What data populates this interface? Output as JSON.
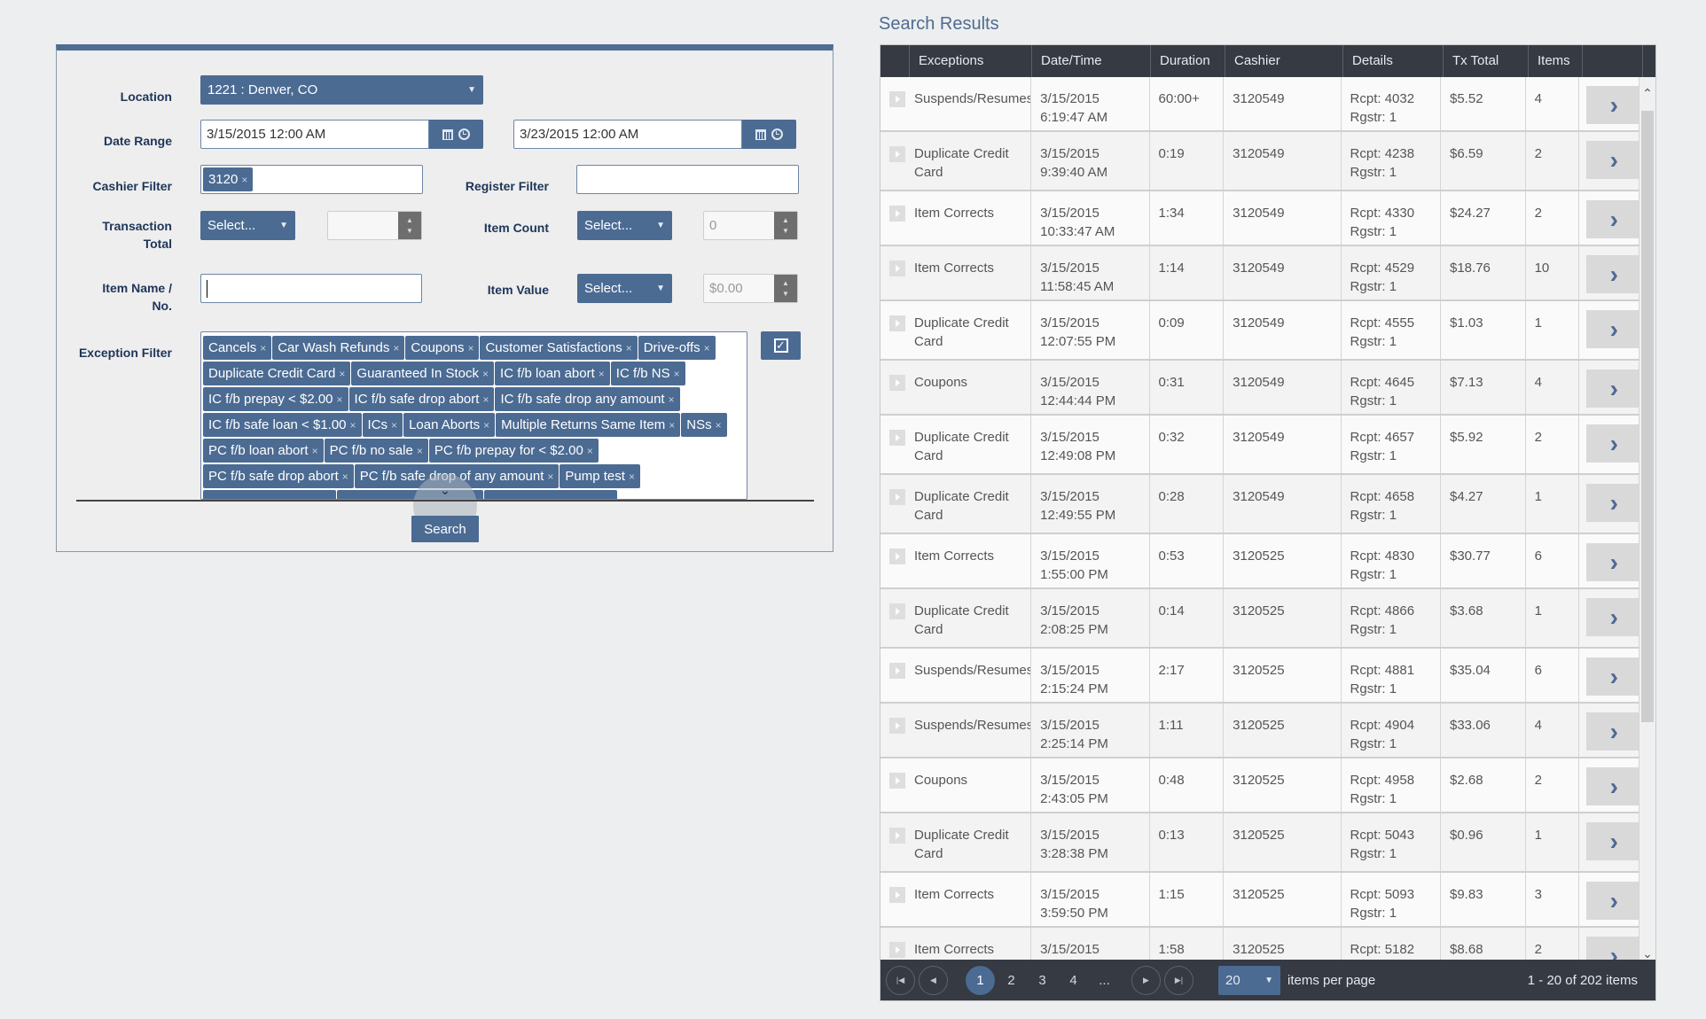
{
  "form": {
    "location_label": "Location",
    "location_value": "1221 : Denver, CO",
    "date_range_label": "Date Range",
    "date_from": "3/15/2015 12:00 AM",
    "date_to": "3/23/2015 12:00 AM",
    "cashier_filter_label": "Cashier Filter",
    "cashier_tags": [
      "3120"
    ],
    "register_filter_label": "Register Filter",
    "register_filter_value": "",
    "transaction_total_label_1": "Transaction",
    "transaction_total_label_2": "Total",
    "transaction_total_operator": "Select...",
    "transaction_total_value": "",
    "item_count_label": "Item Count",
    "item_count_operator": "Select...",
    "item_count_value": "0",
    "item_name_label_1": "Item Name /",
    "item_name_label_2": "No.",
    "item_name_value": "",
    "item_value_label": "Item Value",
    "item_value_operator": "Select...",
    "item_value_value": "$0.00",
    "exception_filter_label": "Exception Filter",
    "exception_tags": [
      "Cancels",
      "Car Wash Refunds",
      "Coupons",
      "Customer Satisfactions",
      "Drive-offs",
      "Duplicate Credit Card",
      "Guaranteed In Stock",
      "IC f/b loan abort",
      "IC f/b NS",
      "IC f/b prepay < $2.00",
      "IC f/b safe drop abort",
      "IC f/b safe drop any amount",
      "IC f/b safe loan < $1.00",
      "ICs",
      "Loan Aborts",
      "Multiple Returns Same Item",
      "NSs",
      "PC f/b loan abort",
      "PC f/b no sale",
      "PC f/b prepay for < $2.00",
      "PC f/b safe drop abort",
      "PC f/b safe drop of any amount",
      "Pump test"
    ],
    "search_label": "Search",
    "remove_glyph": "×"
  },
  "results": {
    "title": "Search Results",
    "columns": [
      "Exceptions",
      "Date/Time",
      "Duration",
      "Cashier",
      "Details",
      "Tx Total",
      "Items"
    ],
    "rows": [
      {
        "exception": "Suspends/Resumes",
        "date": "3/15/2015",
        "time": "6:19:47 AM",
        "duration": "60:00+",
        "cashier": "3120549",
        "rcpt": "Rcpt: 4032",
        "rgstr": "Rgstr: 1",
        "total": "$5.52",
        "items": "4"
      },
      {
        "exception": "Duplicate Credit Card",
        "date": "3/15/2015",
        "time": "9:39:40 AM",
        "duration": "0:19",
        "cashier": "3120549",
        "rcpt": "Rcpt: 4238",
        "rgstr": "Rgstr: 1",
        "total": "$6.59",
        "items": "2"
      },
      {
        "exception": "Item Corrects",
        "date": "3/15/2015",
        "time": "10:33:47 AM",
        "duration": "1:34",
        "cashier": "3120549",
        "rcpt": "Rcpt: 4330",
        "rgstr": "Rgstr: 1",
        "total": "$24.27",
        "items": "2"
      },
      {
        "exception": "Item Corrects",
        "date": "3/15/2015",
        "time": "11:58:45 AM",
        "duration": "1:14",
        "cashier": "3120549",
        "rcpt": "Rcpt: 4529",
        "rgstr": "Rgstr: 1",
        "total": "$18.76",
        "items": "10"
      },
      {
        "exception": "Duplicate Credit Card",
        "date": "3/15/2015",
        "time": "12:07:55 PM",
        "duration": "0:09",
        "cashier": "3120549",
        "rcpt": "Rcpt: 4555",
        "rgstr": "Rgstr: 1",
        "total": "$1.03",
        "items": "1"
      },
      {
        "exception": "Coupons",
        "date": "3/15/2015",
        "time": "12:44:44 PM",
        "duration": "0:31",
        "cashier": "3120549",
        "rcpt": "Rcpt: 4645",
        "rgstr": "Rgstr: 1",
        "total": "$7.13",
        "items": "4"
      },
      {
        "exception": "Duplicate Credit Card",
        "date": "3/15/2015",
        "time": "12:49:08 PM",
        "duration": "0:32",
        "cashier": "3120549",
        "rcpt": "Rcpt: 4657",
        "rgstr": "Rgstr: 1",
        "total": "$5.92",
        "items": "2"
      },
      {
        "exception": "Duplicate Credit Card",
        "date": "3/15/2015",
        "time": "12:49:55 PM",
        "duration": "0:28",
        "cashier": "3120549",
        "rcpt": "Rcpt: 4658",
        "rgstr": "Rgstr: 1",
        "total": "$4.27",
        "items": "1"
      },
      {
        "exception": "Item Corrects",
        "date": "3/15/2015",
        "time": "1:55:00 PM",
        "duration": "0:53",
        "cashier": "3120525",
        "rcpt": "Rcpt: 4830",
        "rgstr": "Rgstr: 1",
        "total": "$30.77",
        "items": "6"
      },
      {
        "exception": "Duplicate Credit Card",
        "date": "3/15/2015",
        "time": "2:08:25 PM",
        "duration": "0:14",
        "cashier": "3120525",
        "rcpt": "Rcpt: 4866",
        "rgstr": "Rgstr: 1",
        "total": "$3.68",
        "items": "1"
      },
      {
        "exception": "Suspends/Resumes",
        "date": "3/15/2015",
        "time": "2:15:24 PM",
        "duration": "2:17",
        "cashier": "3120525",
        "rcpt": "Rcpt: 4881",
        "rgstr": "Rgstr: 1",
        "total": "$35.04",
        "items": "6"
      },
      {
        "exception": "Suspends/Resumes",
        "date": "3/15/2015",
        "time": "2:25:14 PM",
        "duration": "1:11",
        "cashier": "3120525",
        "rcpt": "Rcpt: 4904",
        "rgstr": "Rgstr: 1",
        "total": "$33.06",
        "items": "4"
      },
      {
        "exception": "Coupons",
        "date": "3/15/2015",
        "time": "2:43:05 PM",
        "duration": "0:48",
        "cashier": "3120525",
        "rcpt": "Rcpt: 4958",
        "rgstr": "Rgstr: 1",
        "total": "$2.68",
        "items": "2"
      },
      {
        "exception": "Duplicate Credit Card",
        "date": "3/15/2015",
        "time": "3:28:38 PM",
        "duration": "0:13",
        "cashier": "3120525",
        "rcpt": "Rcpt: 5043",
        "rgstr": "Rgstr: 1",
        "total": "$0.96",
        "items": "1"
      },
      {
        "exception": "Item Corrects",
        "date": "3/15/2015",
        "time": "3:59:50 PM",
        "duration": "1:15",
        "cashier": "3120525",
        "rcpt": "Rcpt: 5093",
        "rgstr": "Rgstr: 1",
        "total": "$9.83",
        "items": "3"
      },
      {
        "exception": "Item Corrects",
        "date": "3/15/2015",
        "time": "",
        "duration": "1:58",
        "cashier": "3120525",
        "rcpt": "Rcpt: 5182",
        "rgstr": "",
        "total": "$8.68",
        "items": "2"
      }
    ],
    "pager": {
      "pages": [
        "1",
        "2",
        "3",
        "4",
        "..."
      ],
      "current_page": "1",
      "page_size": "20",
      "page_size_label": "items per page",
      "summary": "1 - 20 of 202 items"
    }
  },
  "colors": {
    "accent": "#4b6b93",
    "header_dark": "#353a43",
    "label": "#1e3558",
    "background": "#eceef0"
  }
}
